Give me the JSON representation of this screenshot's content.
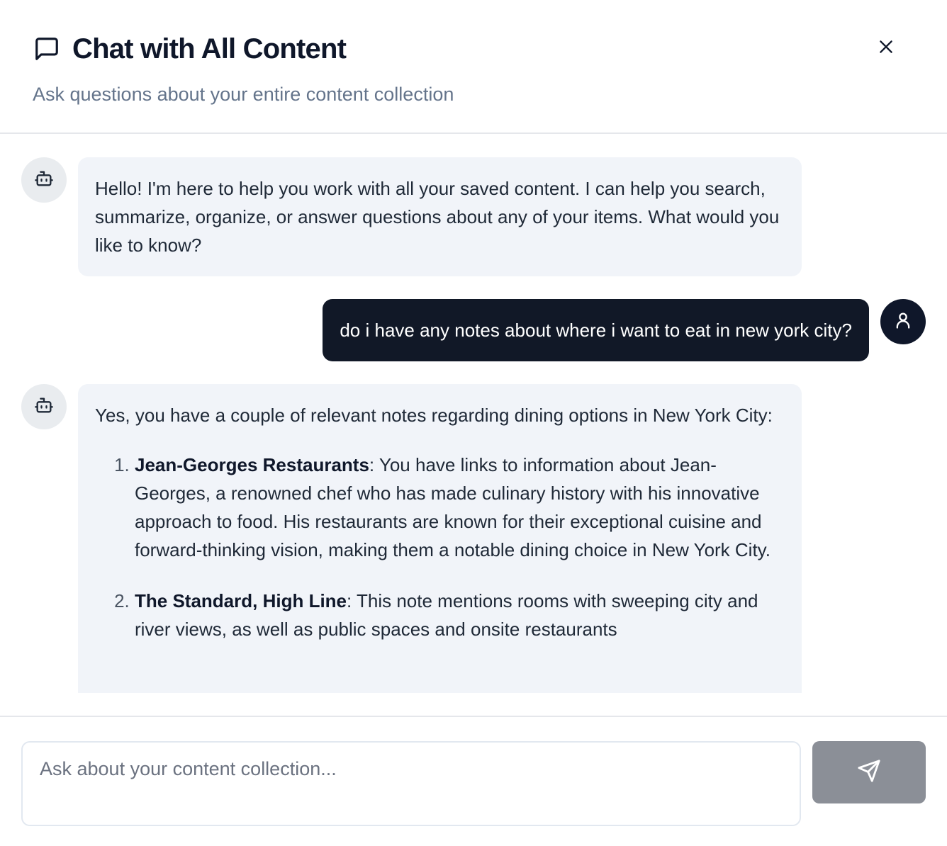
{
  "header": {
    "title": "Chat with All Content",
    "subtitle": "Ask questions about your entire content collection",
    "title_icon": "message-square-icon",
    "close_icon": "close-icon"
  },
  "messages": [
    {
      "role": "assistant",
      "avatar_icon": "bot-icon",
      "text": "Hello! I'm here to help you work with all your saved content. I can help you search, summarize, organize, or answer questions about any of your items. What would you like to know?"
    },
    {
      "role": "user",
      "avatar_icon": "user-icon",
      "text": "do i have any notes about where i want to eat in new york city?"
    },
    {
      "role": "assistant",
      "avatar_icon": "bot-icon",
      "intro": "Yes, you have a couple of relevant notes regarding dining options in New York City:",
      "items": [
        {
          "title": "Jean-Georges Restaurants",
          "body": ": You have links to information about Jean-Georges, a renowned chef who has made culinary history with his innovative approach to food. His restaurants are known for their exceptional cuisine and forward-thinking vision, making them a notable dining choice in New York City."
        },
        {
          "title": "The Standard, High Line",
          "body": ": This note mentions rooms with sweeping city and river views, as well as public spaces and onsite restaurants"
        }
      ]
    }
  ],
  "composer": {
    "placeholder": "Ask about your content collection...",
    "value": "",
    "send_icon": "send-icon"
  },
  "colors": {
    "user_bubble": "#111827",
    "bot_bubble": "#f1f4f9",
    "send_button": "#8b8f97",
    "subtitle": "#64748b"
  }
}
